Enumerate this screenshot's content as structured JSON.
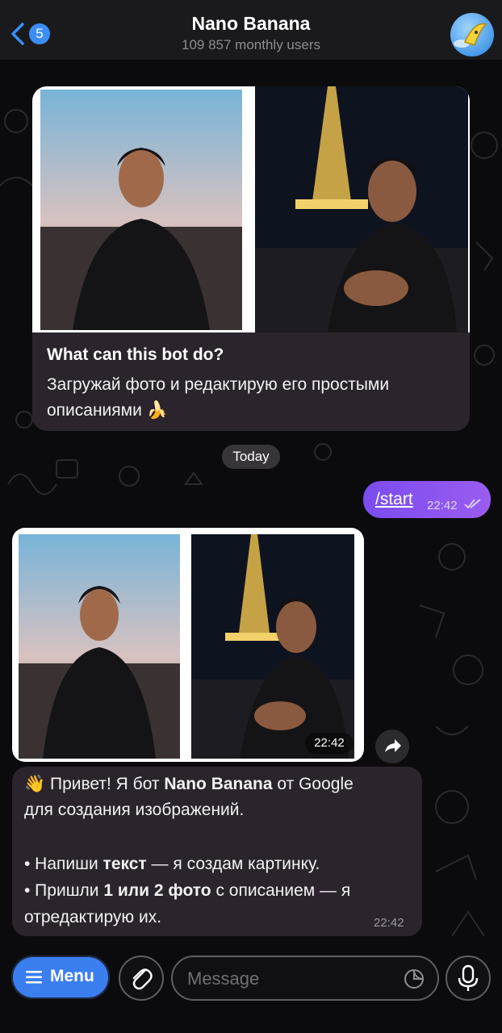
{
  "header": {
    "badge_count": "5",
    "title": "Nano Banana",
    "subtitle": "109 857 monthly users"
  },
  "intro": {
    "title": "What can this bot do?",
    "text": "Загружай фото и редактирую его простыми описаниями 🍌"
  },
  "chat": {
    "date_label": "Today",
    "outgoing": {
      "text": "/start",
      "time": "22:42"
    },
    "image_time": "22:42",
    "reply": {
      "line1_pre": "👋 Привет! Я бот ",
      "line1_bold": "Nano Banana",
      "line1_post": " от Google",
      "line2": "для создания изображений.",
      "line3_pre": "• Напиши ",
      "line3_bold": "текст",
      "line3_post": " — я создам картинку.",
      "line4_pre": "• Пришли ",
      "line4_bold": "1 или 2 фото",
      "line4_post": " с описанием — я",
      "line5": "отредактирую их.",
      "time": "22:42"
    }
  },
  "input_bar": {
    "menu_label": "Menu",
    "message_placeholder": "Message"
  },
  "colors": {
    "accent": "#3b7ef0",
    "outgoing_bubble": "#8a55f0",
    "incoming_bubble": "#2b242d",
    "header_bg": "#1a1a1c"
  },
  "icons": [
    "back-chevron-icon",
    "banana-avatar-icon",
    "double-check-icon",
    "share-icon",
    "hamburger-icon",
    "attach-icon",
    "sticker-icon",
    "microphone-icon"
  ]
}
